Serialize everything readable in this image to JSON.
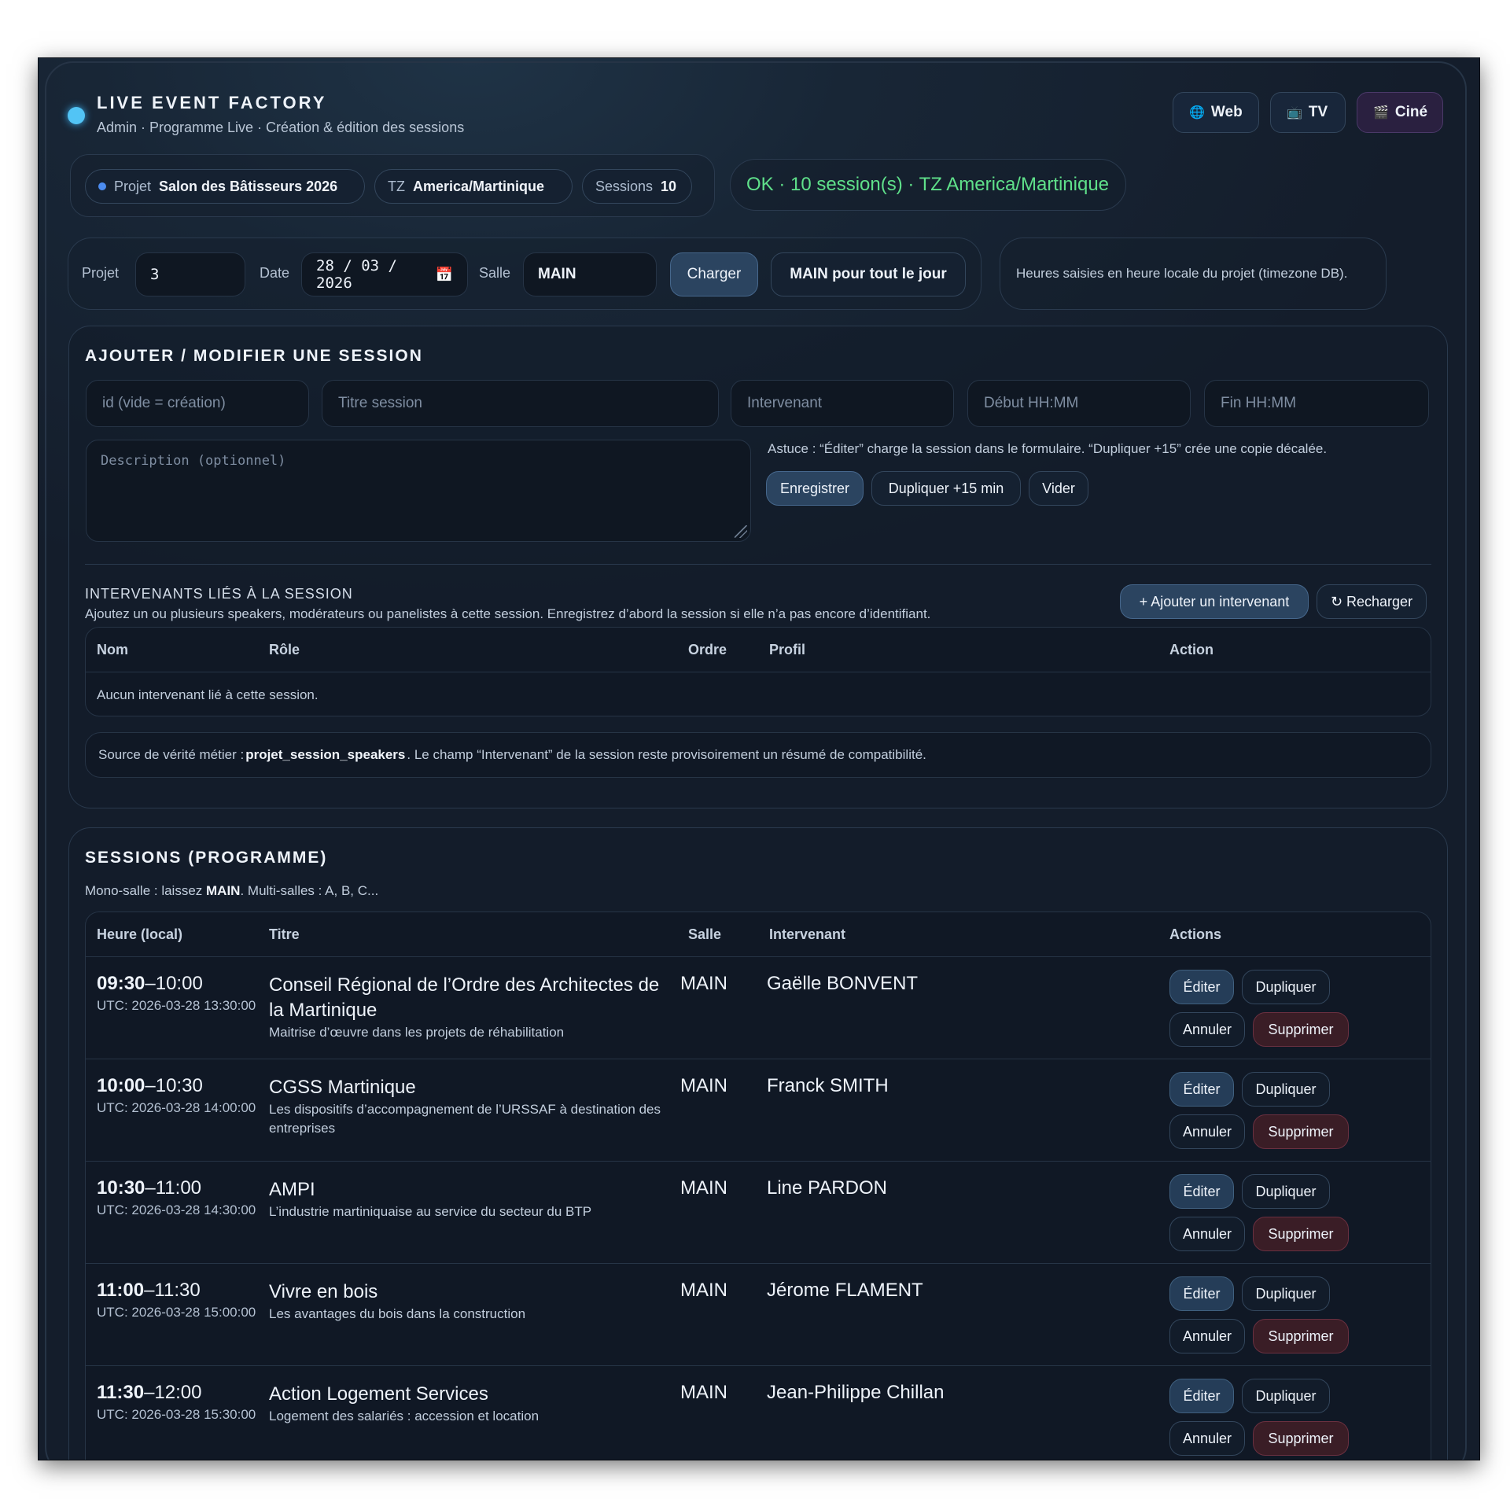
{
  "header": {
    "title": "LIVE EVENT FACTORY",
    "subtitle": "Admin · Programme Live · Création & édition des sessions",
    "views": [
      {
        "label": "Web",
        "icon": "globe-icon"
      },
      {
        "label": "TV",
        "icon": "tv-icon"
      },
      {
        "label": "Ciné",
        "icon": "clapperboard-icon"
      }
    ]
  },
  "pills": {
    "project_label": "Projet",
    "project_value": "Salon des Bâtisseurs 2026",
    "tz_label": "TZ",
    "tz_value": "America/Martinique",
    "sessions_label": "Sessions",
    "sessions_value": "10",
    "status": "OK · 10 session(s) · TZ America/Martinique"
  },
  "controls": {
    "project_label": "Projet",
    "project_value": "3",
    "date_label": "Date",
    "date_value": "28 / 03 / 2026",
    "room_label": "Salle",
    "room_value": "MAIN",
    "load_button": "Charger",
    "main_all_day_button": "MAIN pour tout le jour",
    "hint": "Heures saisies en heure locale du projet (timezone DB)."
  },
  "editor": {
    "title": "AJOUTER / MODIFIER UNE SESSION",
    "placeholders": {
      "id": "id (vide = création)",
      "title": "Titre session",
      "speaker": "Intervenant",
      "start": "Début HH:MM",
      "end": "Fin HH:MM",
      "description": "Description (optionnel)"
    },
    "tip": "Astuce : “Éditer” charge la session dans le formulaire. “Dupliquer +15” crée une copie décalée.",
    "save_button": "Enregistrer",
    "duplicate_button": "Dupliquer +15 min",
    "clear_button": "Vider",
    "speakers_title": "INTERVENANTS LIÉS À LA SESSION",
    "speakers_desc": "Ajoutez un ou plusieurs speakers, modérateurs ou panelistes à cette session. Enregistrez d’abord la session si elle n’a pas encore d’identifiant.",
    "add_speaker_button": "+ Ajouter un intervenant",
    "reload_button": "↻ Recharger",
    "speakers_columns": [
      "Nom",
      "Rôle",
      "Ordre",
      "Profil",
      "Action"
    ],
    "speakers_empty": "Aucun intervenant lié à cette session.",
    "note_prefix": "Source de vérité métier :",
    "note_bold": "projet_session_speakers",
    "note_suffix": ". Le champ “Intervenant” de la session reste provisoirement un résumé de compatibilité."
  },
  "sessions": {
    "title": "SESSIONS (PROGRAMME)",
    "hint_prefix": "Mono-salle : laissez",
    "hint_bold": "MAIN",
    "hint_suffix": ". Multi-salles : A, B, C...",
    "columns": [
      "Heure (local)",
      "Titre",
      "Salle",
      "Intervenant",
      "Actions"
    ],
    "actions": {
      "edit": "Éditer",
      "duplicate": "Dupliquer",
      "cancel": "Annuler",
      "delete": "Supprimer"
    },
    "rows": [
      {
        "start": "09:30",
        "end": "–10:00",
        "utc": "UTC: 2026-03-28 13:30:00",
        "title": "Conseil Régional de l’Ordre des Architectes de la Martinique",
        "desc": "Maitrise d’œuvre dans les projets de réhabilitation",
        "room": "MAIN",
        "speaker": "Gaëlle BONVENT"
      },
      {
        "start": "10:00",
        "end": "–10:30",
        "utc": "UTC: 2026-03-28 14:00:00",
        "title": "CGSS Martinique",
        "desc": "Les dispositifs d’accompagnement de l’URSSAF à destination des entreprises",
        "room": "MAIN",
        "speaker": "Franck SMITH"
      },
      {
        "start": "10:30",
        "end": "–11:00",
        "utc": "UTC: 2026-03-28 14:30:00",
        "title": "AMPI",
        "desc": "L’industrie martiniquaise au service du secteur du BTP",
        "room": "MAIN",
        "speaker": "Line PARDON"
      },
      {
        "start": "11:00",
        "end": "–11:30",
        "utc": "UTC: 2026-03-28 15:00:00",
        "title": "Vivre en bois",
        "desc": "Les avantages du bois dans la construction",
        "room": "MAIN",
        "speaker": "Jérome FLAMENT"
      },
      {
        "start": "11:30",
        "end": "–12:00",
        "utc": "UTC: 2026-03-28 15:30:00",
        "title": "Action Logement Services",
        "desc": "Logement des salariés : accession et location",
        "room": "MAIN",
        "speaker": "Jean-Philippe Chillan"
      }
    ]
  }
}
